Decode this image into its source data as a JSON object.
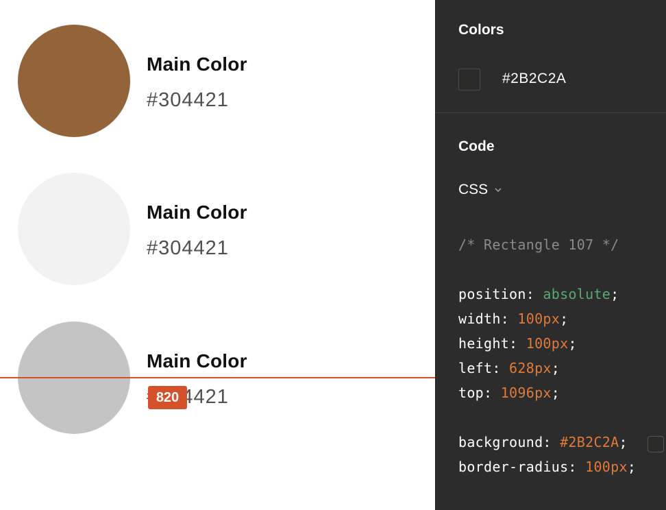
{
  "swatches": [
    {
      "name": "Main Color",
      "hex": "#304421",
      "fill": "#93643a"
    },
    {
      "name": "Main Color",
      "hex": "#304421",
      "fill": "#f2f2f2"
    },
    {
      "name": "Main Color",
      "hex": "#304421",
      "fill": "#c4c4c4"
    }
  ],
  "measurement": {
    "value": "820",
    "color": "#d4512b"
  },
  "inspector": {
    "colors_title": "Colors",
    "color_value": "#2B2C2A",
    "code_title": "Code",
    "language": "CSS",
    "code": {
      "comment": "/* Rectangle 107 */",
      "position": {
        "prop": "position: ",
        "value": "absolute",
        "end": ";"
      },
      "width": {
        "prop": "width: ",
        "value": "100px",
        "end": ";"
      },
      "height": {
        "prop": "height: ",
        "value": "100px",
        "end": ";"
      },
      "left": {
        "prop": "left: ",
        "value": "628px",
        "end": ";"
      },
      "top": {
        "prop": "top: ",
        "value": "1096px",
        "end": ";"
      },
      "background": {
        "prop": "background: ",
        "value": "#2B2C2A",
        "end": ";"
      },
      "border_radius": {
        "prop": "border-radius: ",
        "value": "100px",
        "end": ";"
      }
    }
  }
}
